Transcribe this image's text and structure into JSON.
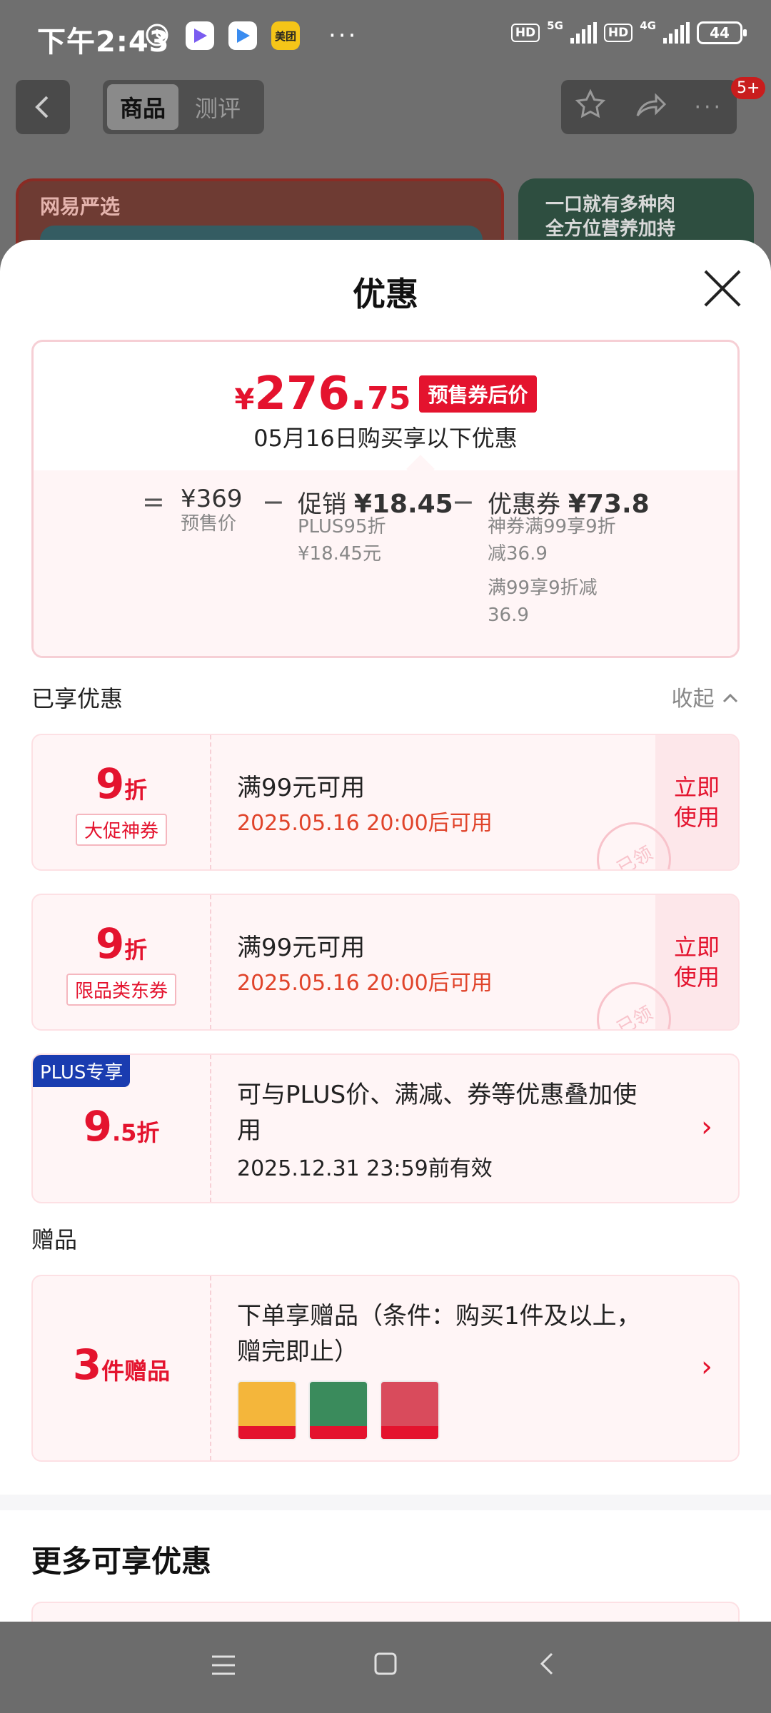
{
  "status_bar": {
    "time": "下午2:43",
    "app_icons": [
      "alarm-icon",
      "video-app-icon",
      "video-app-icon",
      "meituan-icon"
    ],
    "meituan_label": "美团",
    "overflow": "···",
    "hd1": "HD",
    "net1": "5G",
    "hd2": "HD",
    "net2": "4G",
    "battery": "44"
  },
  "nav": {
    "tabs": [
      "商品",
      "测评"
    ],
    "badge": "5+"
  },
  "background": {
    "brand": "网易严选",
    "promo_line1": "一口就有多种肉",
    "promo_line2": "全方位营养加持"
  },
  "sheet": {
    "title": "优惠",
    "price": {
      "currency": "¥",
      "integer": "276.",
      "decimal": "75",
      "tag": "预售券后价",
      "subtitle": "05月16日购买享以下优惠",
      "equals": "=",
      "minus": "−",
      "presale_value": "¥369",
      "presale_label": "预售价",
      "promo_label": "促销",
      "promo_value": "¥18.45",
      "promo_detail1": "PLUS95折",
      "promo_detail2": "¥18.45元",
      "coupon_label": "优惠券",
      "coupon_value": "¥73.8",
      "coupon_detail1": "神券满99享9折",
      "coupon_detail2": "减36.9",
      "coupon_detail3": "满99享9折减",
      "coupon_detail4": "36.9"
    },
    "enjoyed_label": "已享优惠",
    "collapse_label": "收起",
    "coupons": [
      {
        "discount": "9",
        "unit": "折",
        "tag": "大促神券",
        "title": "满99元可用",
        "date": "2025.05.16 20:00后可用",
        "action_line1": "立即",
        "action_line2": "使用",
        "stamp": "已领"
      },
      {
        "discount": "9",
        "unit": "折",
        "tag": "限品类东券",
        "title": "满99元可用",
        "date": "2025.05.16 20:00后可用",
        "action_line1": "立即",
        "action_line2": "使用",
        "stamp": "已领"
      }
    ],
    "plus_offer": {
      "tag": "PLUS专享",
      "discount": "9",
      "unit": ".5折",
      "title_line1": "可与PLUS价、满减、券等优惠叠加使",
      "title_line2": "用",
      "date": "2025.12.31 23:59前有效"
    },
    "gift_label": "赠品",
    "gift": {
      "count": "3",
      "unit": "件赠品",
      "title_line1": "下单享赠品（条件：购买1件及以上，",
      "title_line2": "赠完即止）",
      "thumbs": [
        "gift-thumb-1",
        "gift-thumb-2",
        "gift-thumb-3"
      ]
    },
    "more_title": "更多可享优惠"
  },
  "colors": {
    "accent_red": "#e4132e",
    "date_orange": "#e0432a",
    "plus_blue": "#1a3cb0",
    "coupon_bg": "#fff5f6"
  }
}
